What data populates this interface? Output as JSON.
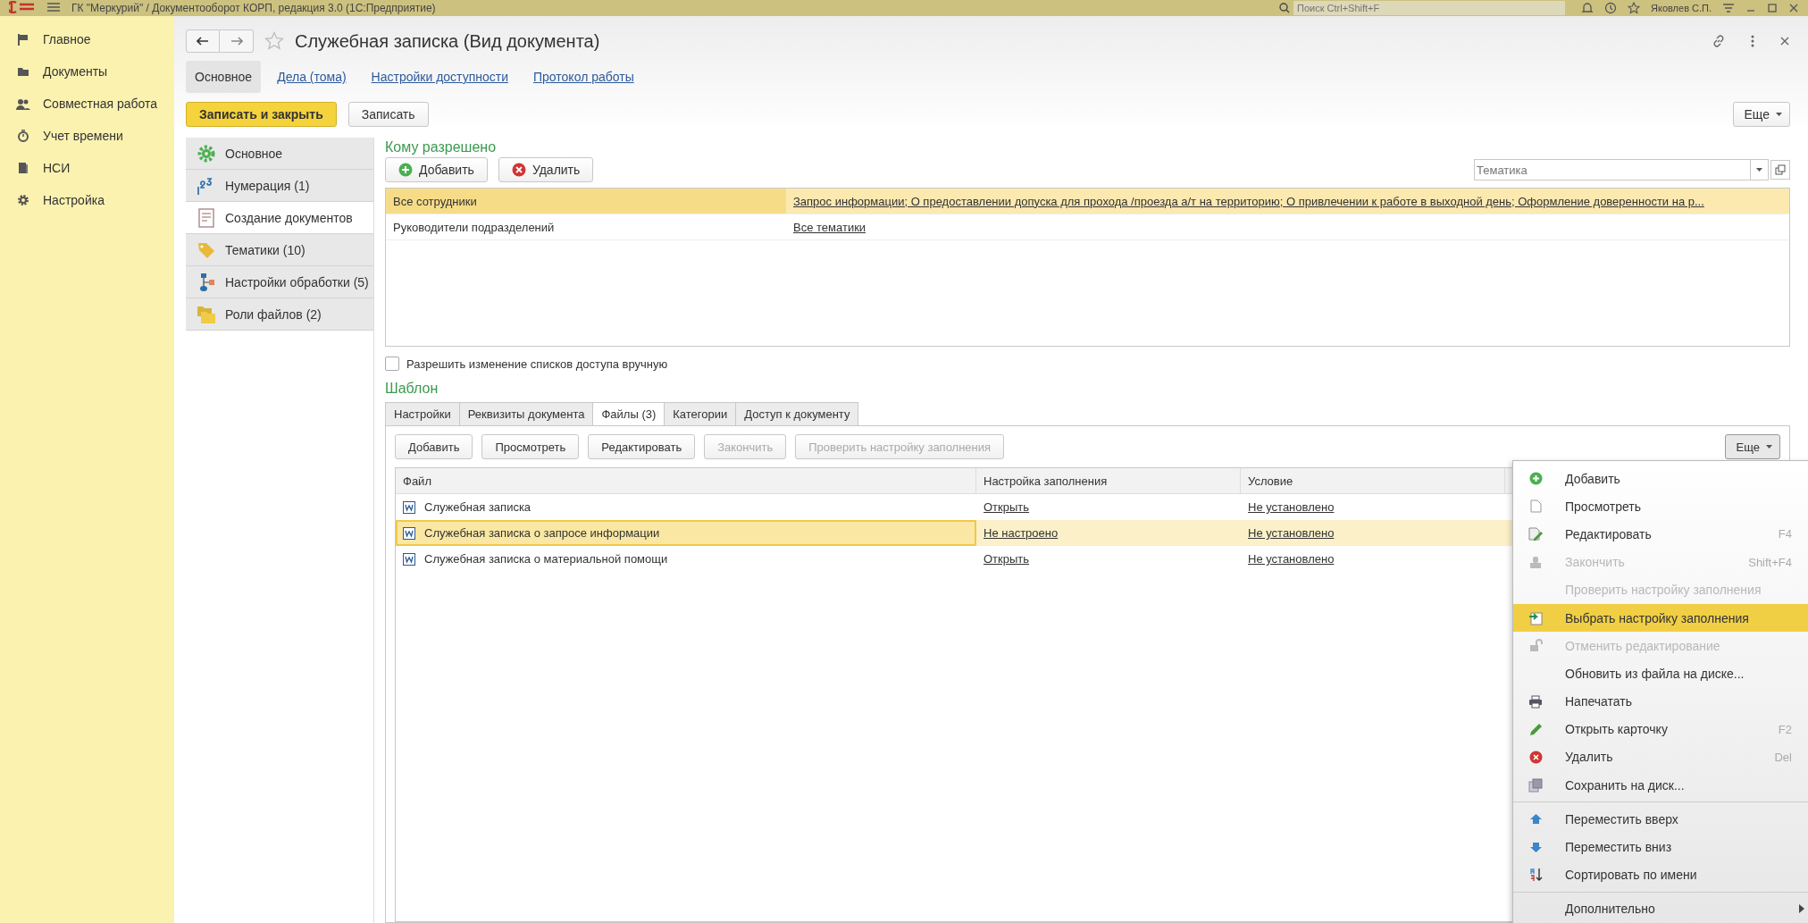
{
  "app_bar": {
    "title": "ГК \"Меркурий\" / Документооборот КОРП, редакция 3.0  (1С:Предприятие)",
    "search_placeholder": "Поиск Ctrl+Shift+F",
    "user": "Яковлев С.П."
  },
  "sidebar": {
    "items": [
      {
        "label": "Главное",
        "selected": false
      },
      {
        "label": "Документы",
        "selected": false
      },
      {
        "label": "Совместная работа",
        "selected": false
      },
      {
        "label": "Учет времени",
        "selected": false
      },
      {
        "label": "НСИ",
        "selected": false
      },
      {
        "label": "Настройка",
        "selected": false
      }
    ]
  },
  "window": {
    "title": "Служебная записка (Вид документа)"
  },
  "tabs": [
    {
      "label": "Основное",
      "selected": true
    },
    {
      "label": "Дела (тома)",
      "selected": false
    },
    {
      "label": "Настройки доступности",
      "selected": false
    },
    {
      "label": "Протокол работы",
      "selected": false
    }
  ],
  "toolbar": {
    "primary": "Записать и закрыть",
    "secondary": "Записать",
    "more": "Еще"
  },
  "sections": [
    {
      "label": "Основное",
      "selected": false
    },
    {
      "label": "Нумерация (1)",
      "selected": false
    },
    {
      "label": "Создание документов",
      "selected": true
    },
    {
      "label": "Тематики (10)",
      "selected": false
    },
    {
      "label": "Настройки обработки (5)",
      "selected": false
    },
    {
      "label": "Роли файлов (2)",
      "selected": false
    }
  ],
  "access": {
    "title": "Кому разрешено",
    "add": "Добавить",
    "delete": "Удалить",
    "topic_placeholder": "Тематика",
    "rows": [
      {
        "who": "Все сотрудники",
        "topics": "Запрос информации; О предоставлении допуска для прохода /проезда а/т на территорию; О привлечении к работе в выходной день; Оформление доверенности на р...",
        "selected": true
      },
      {
        "who": "Руководители подразделений",
        "topics": "Все тематики",
        "selected": false
      }
    ]
  },
  "manual_edit": {
    "label": "Разрешить изменение списков доступа вручную",
    "checked": false
  },
  "template": {
    "title": "Шаблон",
    "tabs": [
      {
        "label": "Настройки",
        "selected": false
      },
      {
        "label": "Реквизиты документа",
        "selected": false
      },
      {
        "label": "Файлы (3)",
        "selected": true
      },
      {
        "label": "Категории",
        "selected": false
      },
      {
        "label": "Доступ к документу",
        "selected": false
      }
    ],
    "buttons": [
      {
        "label": "Добавить",
        "disabled": false
      },
      {
        "label": "Просмотреть",
        "disabled": false
      },
      {
        "label": "Редактировать",
        "disabled": false
      },
      {
        "label": "Закончить",
        "disabled": true
      },
      {
        "label": "Проверить настройку заполнения",
        "disabled": true
      }
    ],
    "more": "Еще",
    "columns": [
      "Файл",
      "Настройка заполнения",
      "Условие"
    ],
    "rows": [
      {
        "file": "Служебная записка",
        "fill": "Открыть",
        "condition": "Не установлено",
        "selected": false
      },
      {
        "file": "Служебная записка о запросе информации",
        "fill": "Не настроено",
        "condition": "Не установлено",
        "selected": true
      },
      {
        "file": "Служебная записка о материальной помощи",
        "fill": "Открыть",
        "condition": "Не установлено",
        "selected": false
      }
    ]
  },
  "context_menu": {
    "groups": [
      [
        {
          "label": "Добавить",
          "disabled": false,
          "selected": false
        },
        {
          "label": "Просмотреть",
          "disabled": false,
          "selected": false
        },
        {
          "label": "Редактировать",
          "shortcut": "F4",
          "disabled": false,
          "selected": false
        },
        {
          "label": "Закончить",
          "shortcut": "Shift+F4",
          "disabled": true,
          "selected": false
        },
        {
          "label": "Проверить настройку заполнения",
          "disabled": true,
          "selected": false
        },
        {
          "label": "Выбрать настройку заполнения",
          "disabled": false,
          "selected": true
        },
        {
          "label": "Отменить редактирование",
          "disabled": true,
          "selected": false
        },
        {
          "label": "Обновить из файла на диске...",
          "disabled": false,
          "selected": false
        },
        {
          "label": "Напечатать",
          "disabled": false,
          "selected": false
        },
        {
          "label": "Открыть карточку",
          "shortcut": "F2",
          "disabled": false,
          "selected": false
        },
        {
          "label": "Удалить",
          "shortcut": "Del",
          "disabled": false,
          "selected": false
        },
        {
          "label": "Сохранить на диск...",
          "disabled": false,
          "selected": false
        }
      ],
      [
        {
          "label": "Переместить вверх",
          "disabled": false,
          "selected": false
        },
        {
          "label": "Переместить вниз",
          "disabled": false,
          "selected": false
        },
        {
          "label": "Сортировать по имени",
          "disabled": false,
          "selected": false
        }
      ],
      [
        {
          "label": "Дополнительно",
          "disabled": false,
          "selected": false,
          "submenu": true
        }
      ]
    ]
  }
}
